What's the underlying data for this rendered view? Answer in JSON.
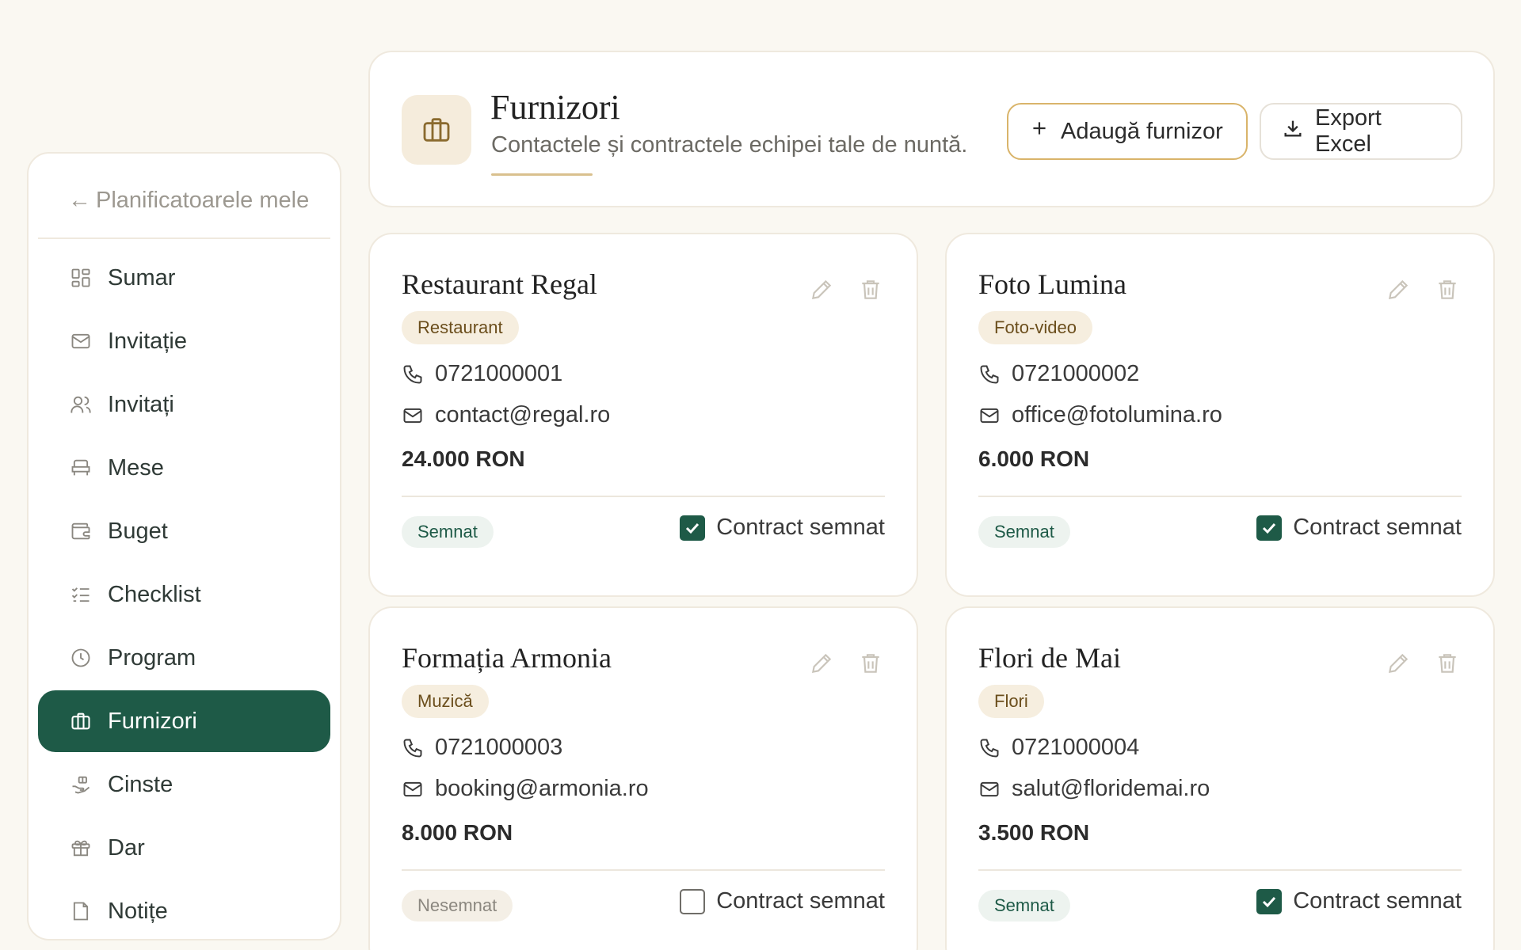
{
  "sidebar": {
    "back_label": "Planificatoarele mele",
    "items": [
      {
        "label": "Sumar",
        "icon": "grid-icon"
      },
      {
        "label": "Invitație",
        "icon": "mail-icon"
      },
      {
        "label": "Invitați",
        "icon": "users-icon"
      },
      {
        "label": "Mese",
        "icon": "chair-icon"
      },
      {
        "label": "Buget",
        "icon": "wallet-icon"
      },
      {
        "label": "Checklist",
        "icon": "checklist-icon"
      },
      {
        "label": "Program",
        "icon": "clock-icon"
      },
      {
        "label": "Furnizori",
        "icon": "briefcase-icon",
        "active": true
      },
      {
        "label": "Cinste",
        "icon": "gift-hand-icon"
      },
      {
        "label": "Dar",
        "icon": "gift-icon"
      },
      {
        "label": "Notițe",
        "icon": "note-icon"
      }
    ]
  },
  "header": {
    "title": "Furnizori",
    "subtitle": "Contactele și contractele echipei tale de nuntă.",
    "add_label": "Adaugă furnizor",
    "export_label": "Export Excel"
  },
  "vendors": [
    {
      "name": "Restaurant Regal",
      "category": "Restaurant",
      "phone": "0721000001",
      "email": "contact@regal.ro",
      "amount": "24.000 RON",
      "status": "Semnat",
      "contract_label": "Contract semnat",
      "signed": true
    },
    {
      "name": "Foto Lumina",
      "category": "Foto-video",
      "phone": "0721000002",
      "email": "office@fotolumina.ro",
      "amount": "6.000 RON",
      "status": "Semnat",
      "contract_label": "Contract semnat",
      "signed": true
    },
    {
      "name": "Formația Armonia",
      "category": "Muzică",
      "phone": "0721000003",
      "email": "booking@armonia.ro",
      "amount": "8.000 RON",
      "status": "Nesemnat",
      "contract_label": "Contract semnat",
      "signed": false
    },
    {
      "name": "Flori de Mai",
      "category": "Flori",
      "phone": "0721000004",
      "email": "salut@floridemai.ro",
      "amount": "3.500 RON",
      "status": "Semnat",
      "contract_label": "Contract semnat",
      "signed": true
    }
  ],
  "colors": {
    "accent": "#1e5a47",
    "background": "#faf8f2",
    "tag_bg": "#f6eedf",
    "gold_border": "#d9b46a"
  }
}
